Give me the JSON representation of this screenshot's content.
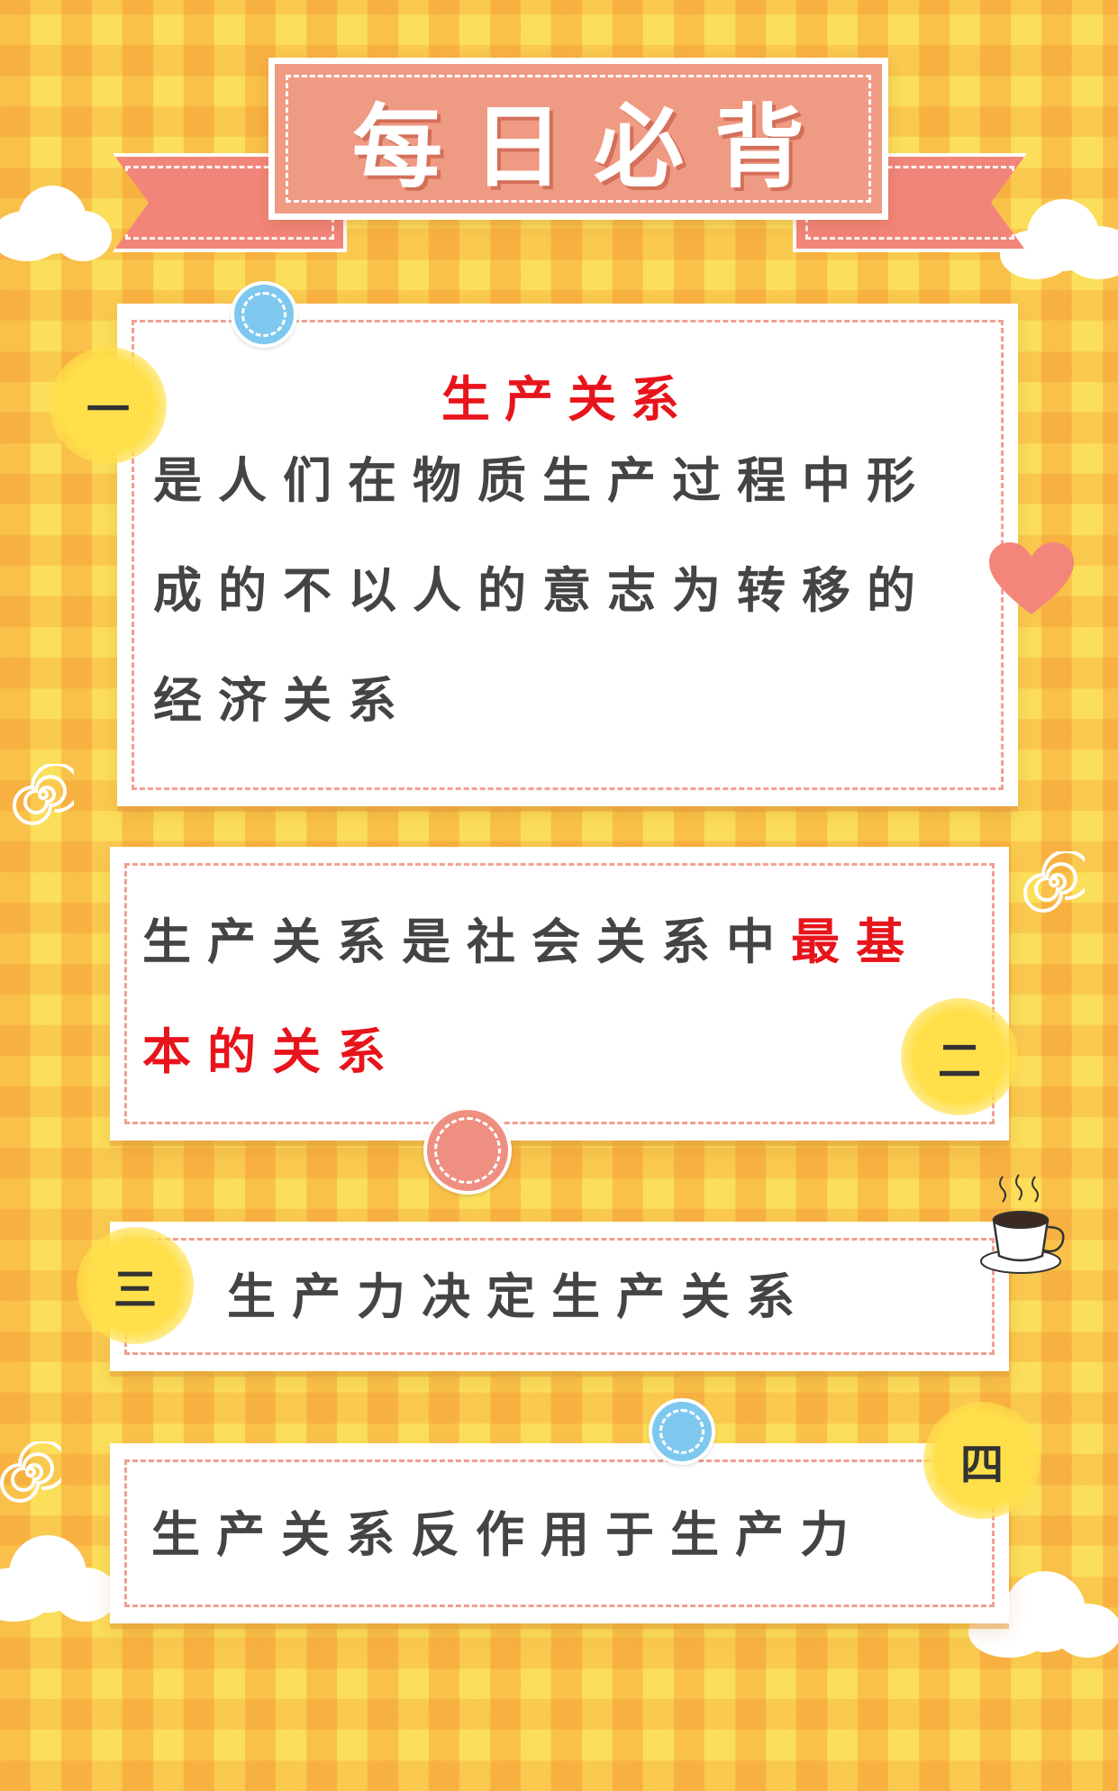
{
  "header": {
    "title": "每日必背"
  },
  "cards": [
    {
      "number": "一",
      "title": "生产关系",
      "lines": [
        "是人们在物质生产过程中形",
        "成的不以人的意志为转移的",
        "经济关系"
      ]
    },
    {
      "number": "二",
      "text_normal": "生产关系是社会关系中",
      "text_red_1": "最基",
      "text_red_2": "本的关系"
    },
    {
      "number": "三",
      "text": "生产力决定生产关系"
    },
    {
      "number": "四",
      "text": "生产关系反作用于生产力"
    }
  ],
  "colors": {
    "background": "#f8d34a",
    "banner": "#ef9a83",
    "highlight_red": "#e8141c",
    "dash_pink": "#f0a092",
    "pin_blue": "#7ec8ef",
    "pin_pink": "#ef8f82"
  },
  "decorations": {
    "heart": "heart-icon",
    "coffee": "coffee-cup-icon",
    "swirl": "swirl-icon",
    "cloud": "cloud-icon"
  }
}
